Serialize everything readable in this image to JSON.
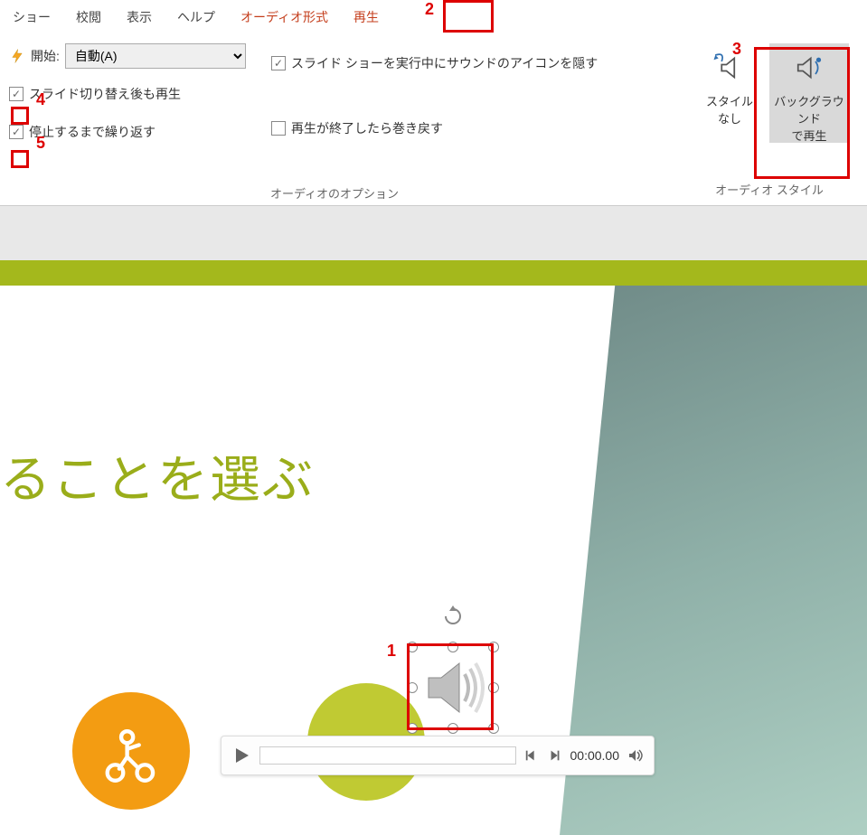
{
  "ribbon": {
    "tabs": {
      "slideshow": "ショー",
      "review": "校閲",
      "view": "表示",
      "help": "ヘルプ",
      "audio_format": "オーディオ形式",
      "playback": "再生"
    },
    "audio_options": {
      "start_label": "開始:",
      "start_value": "自動(A)",
      "play_across": "スライド切り替え後も再生",
      "loop": "停止するまで繰り返す",
      "hide_icon": "スライド ショーを実行中にサウンドのアイコンを隠す",
      "rewind": "再生が終了したら巻き戻す",
      "group_label": "オーディオのオプション"
    },
    "audio_styles": {
      "no_style": {
        "line1": "スタイル",
        "line2": "なし"
      },
      "bg_play": {
        "line1": "バックグラウンド",
        "line2": "で再生"
      },
      "group_label": "オーディオ スタイル"
    }
  },
  "slide": {
    "title_fragment": "ることを選ぶ"
  },
  "media": {
    "time": "00:00.00"
  },
  "annotations": {
    "n1": "1",
    "n2": "2",
    "n3": "3",
    "n4": "4",
    "n5": "5"
  }
}
